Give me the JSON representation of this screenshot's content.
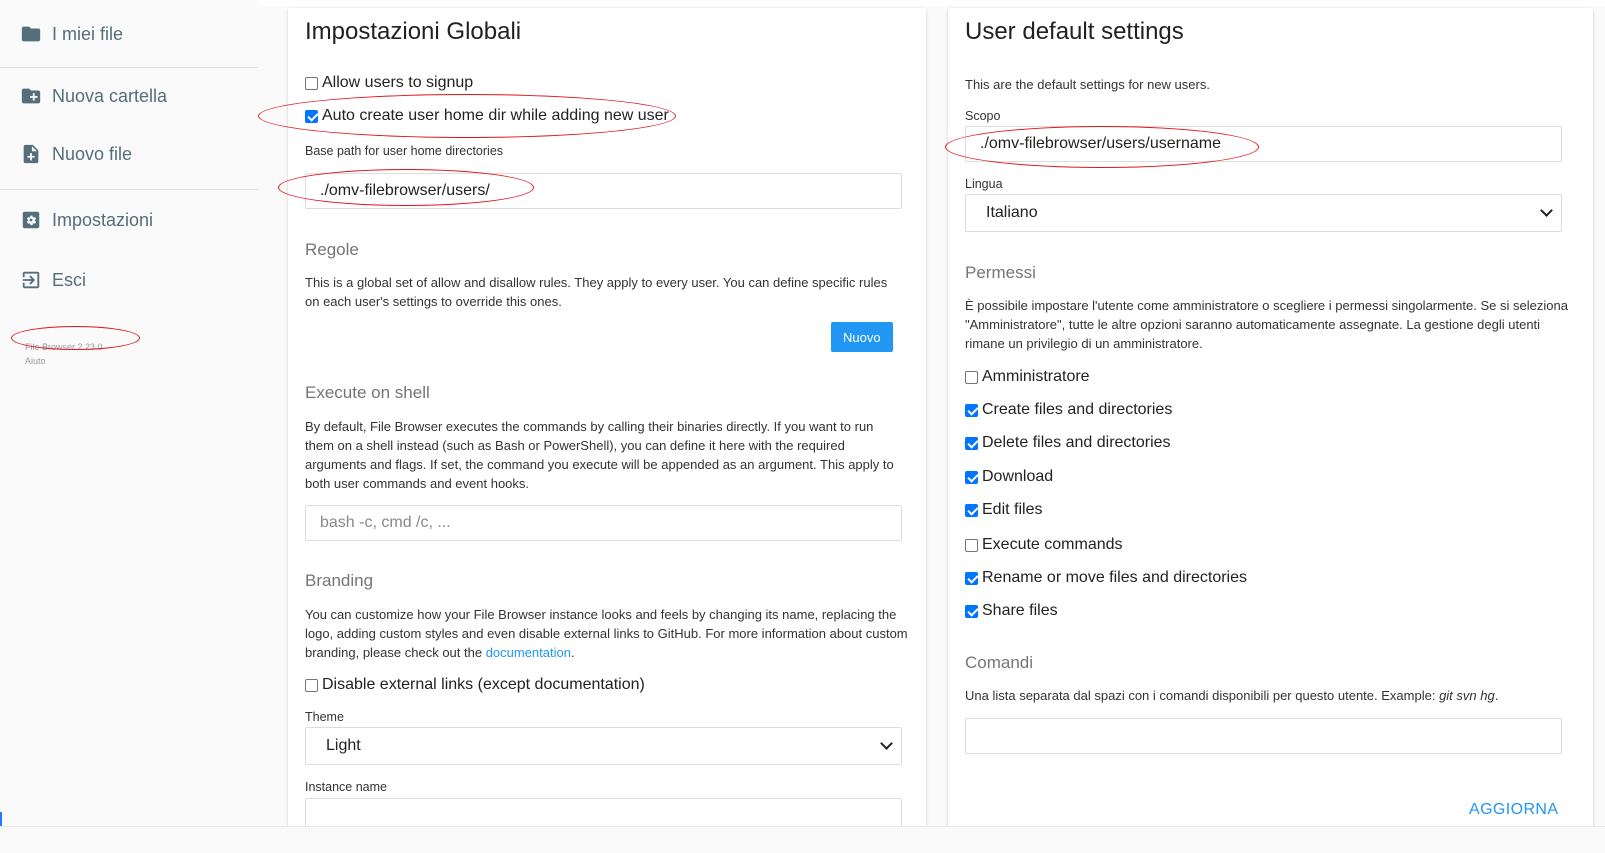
{
  "sidebar": {
    "items": [
      {
        "label": "I miei file",
        "icon": "folder-icon"
      },
      {
        "label": "Nuova cartella",
        "icon": "folder-plus-icon"
      },
      {
        "label": "Nuovo file",
        "icon": "file-plus-icon"
      },
      {
        "label": "Impostazioni",
        "icon": "gear-icon"
      },
      {
        "label": "Esci",
        "icon": "logout-icon"
      }
    ],
    "version": "File Browser 2.23.0",
    "help": "Aiuto"
  },
  "global": {
    "title": "Impostazioni Globali",
    "allow_signup": {
      "label": "Allow users to signup",
      "checked": false
    },
    "auto_home": {
      "label": "Auto create user home dir while adding new user",
      "checked": true
    },
    "base_path_label": "Base path for user home directories",
    "base_path_value": "./omv-filebrowser/users/",
    "rules": {
      "title": "Regole",
      "desc": "This is a global set of allow and disallow rules. They apply to every user. You can define specific rules on each user's settings to override this ones.",
      "button": "Nuovo"
    },
    "shell": {
      "title": "Execute on shell",
      "desc": "By default, File Browser executes the commands by calling their binaries directly. If you want to run them on a shell instead (such as Bash or PowerShell), you can define it here with the required arguments and flags. If set, the command you execute will be appended as an argument. This apply to both user commands and event hooks.",
      "placeholder": "bash -c, cmd /c, ..."
    },
    "branding": {
      "title": "Branding",
      "desc_pre": "You can customize how your File Browser instance looks and feels by changing its name, replacing the logo, adding custom styles and even disable external links to GitHub. For more information about custom branding, please check out the ",
      "link": "documentation",
      "desc_post": ".",
      "disable_links": {
        "label": "Disable external links (except documentation)",
        "checked": false
      },
      "theme_label": "Theme",
      "theme_value": "Light",
      "instance_label": "Instance name"
    }
  },
  "user": {
    "title": "User default settings",
    "desc": "This are the default settings for new users.",
    "scope_label": "Scopo",
    "scope_value": "./omv-filebrowser/users/username",
    "lang_label": "Lingua",
    "lang_value": "Italiano",
    "perms": {
      "title": "Permessi",
      "desc": "È possibile impostare l'utente come amministratore o scegliere i permessi singolarmente. Se si seleziona \"Amministratore\", tutte le altre opzioni saranno automaticamente assegnate. La gestione degli utenti rimane un privilegio di un amministratore.",
      "items": [
        {
          "label": "Amministratore",
          "checked": false
        },
        {
          "label": "Create files and directories",
          "checked": true
        },
        {
          "label": "Delete files and directories",
          "checked": true
        },
        {
          "label": "Download",
          "checked": true
        },
        {
          "label": "Edit files",
          "checked": true
        },
        {
          "label": "Execute commands",
          "checked": false
        },
        {
          "label": "Rename or move files and directories",
          "checked": true
        },
        {
          "label": "Share files",
          "checked": true
        }
      ]
    },
    "commands": {
      "title": "Comandi",
      "desc_pre": "Una lista separata dal spazi con i comandi disponibili per questo utente. Example: ",
      "desc_example": "git svn hg",
      "desc_post": "."
    },
    "update_button": "AGGIORNA"
  },
  "colors": {
    "accent": "#2196f3",
    "annotation": "#e0141c",
    "checkbox": "#0075ff"
  }
}
